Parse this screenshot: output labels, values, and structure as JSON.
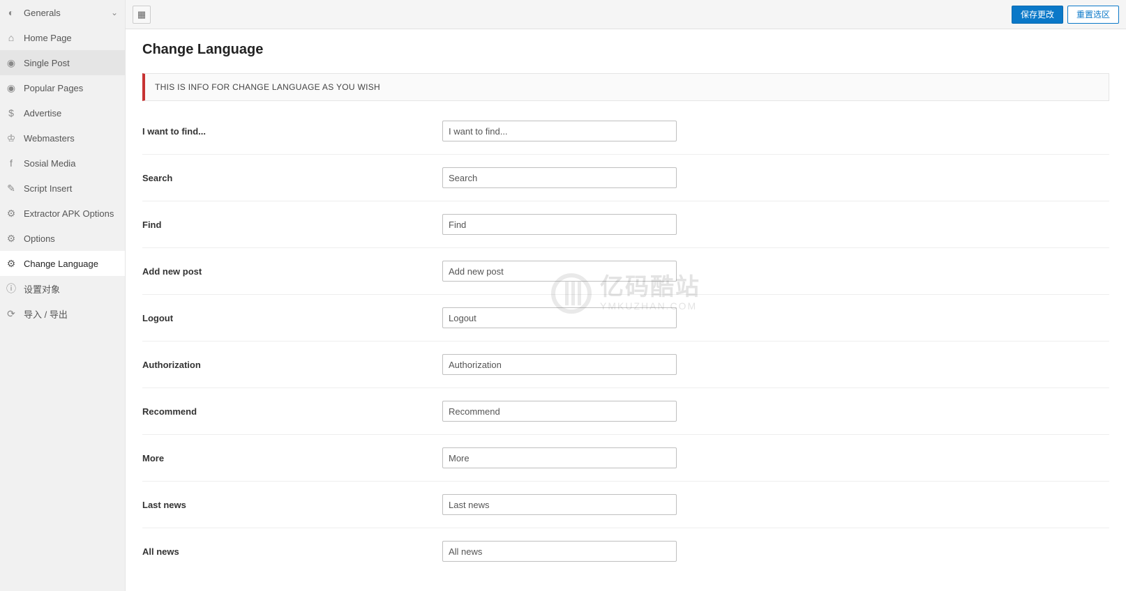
{
  "sidebar": {
    "items": [
      {
        "label": "Generals",
        "icon": "◐",
        "name": "generals",
        "expandable": true
      },
      {
        "label": "Home Page",
        "icon": "⌂",
        "name": "home-page"
      },
      {
        "label": "Single Post",
        "icon": "◉",
        "name": "single-post",
        "selected": true
      },
      {
        "label": "Popular Pages",
        "icon": "◉",
        "name": "popular-pages"
      },
      {
        "label": "Advertise",
        "icon": "$",
        "name": "advertise"
      },
      {
        "label": "Webmasters",
        "icon": "♔",
        "name": "webmasters"
      },
      {
        "label": "Sosial Media",
        "icon": "f",
        "name": "sosial-media"
      },
      {
        "label": "Script Insert",
        "icon": "✎",
        "name": "script-insert"
      },
      {
        "label": "Extractor APK Options",
        "icon": "⚙",
        "name": "extractor-apk-options"
      },
      {
        "label": "Options",
        "icon": "⚙",
        "name": "options"
      },
      {
        "label": "Change Language",
        "icon": "⚙",
        "name": "change-language",
        "current": true
      },
      {
        "label": "设置对象",
        "icon": "ⓘ",
        "name": "set-object"
      },
      {
        "label": "导入 / 导出",
        "icon": "⟳",
        "name": "import-export"
      }
    ]
  },
  "toolbar": {
    "save_label": "保存更改",
    "reset_label": "重置选区"
  },
  "page": {
    "title": "Change Language",
    "info": "THIS IS INFO FOR CHANGE LANGUAGE AS YOU WISH"
  },
  "fields": [
    {
      "label": "I want to find...",
      "value": "I want to find...",
      "name": "i-want-to-find"
    },
    {
      "label": "Search",
      "value": "Search",
      "name": "search"
    },
    {
      "label": "Find",
      "value": "Find",
      "name": "find"
    },
    {
      "label": "Add new post",
      "value": "Add new post",
      "name": "add-new-post"
    },
    {
      "label": "Logout",
      "value": "Logout",
      "name": "logout"
    },
    {
      "label": "Authorization",
      "value": "Authorization",
      "name": "authorization"
    },
    {
      "label": "Recommend",
      "value": "Recommend",
      "name": "recommend"
    },
    {
      "label": "More",
      "value": "More",
      "name": "more"
    },
    {
      "label": "Last news",
      "value": "Last news",
      "name": "last-news"
    },
    {
      "label": "All news",
      "value": "All news",
      "name": "all-news"
    }
  ],
  "watermark": {
    "line1": "亿码酷站",
    "line2": "YMKUZHAN.COM"
  }
}
